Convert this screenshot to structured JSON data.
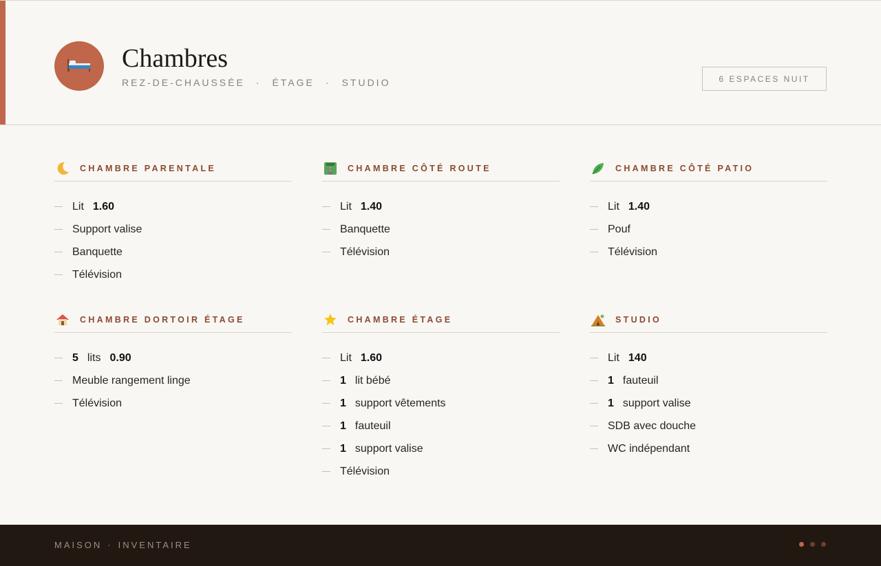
{
  "header": {
    "title": "Chambres",
    "subtitle_parts": [
      "REZ-DE-CHAUSSÉE",
      "ÉTAGE",
      "STUDIO"
    ],
    "separator": "·",
    "count_label": "6 ESPACES NUIT",
    "badge_icon": "bed-icon",
    "accent_color": "#c0664a"
  },
  "rooms": [
    {
      "title": "CHAMBRE PARENTALE",
      "icon": "moon-icon",
      "items": [
        {
          "text": "Lit",
          "value": "1.60"
        },
        {
          "text": "Support valise"
        },
        {
          "text": "Banquette"
        },
        {
          "text": "Télévision"
        }
      ]
    },
    {
      "title": "CHAMBRE CÔTÉ ROUTE",
      "icon": "road-icon",
      "items": [
        {
          "text": "Lit",
          "value": "1.40"
        },
        {
          "text": "Banquette"
        },
        {
          "text": "Télévision"
        }
      ]
    },
    {
      "title": "CHAMBRE CÔTÉ PATIO",
      "icon": "leaf-icon",
      "items": [
        {
          "text": "Lit",
          "value": "1.40"
        },
        {
          "text": "Pouf"
        },
        {
          "text": "Télévision"
        }
      ]
    },
    {
      "title": "CHAMBRE DORTOIR ÉTAGE",
      "icon": "house-icon",
      "items": [
        {
          "qty": "5",
          "text": "lits",
          "value": "0.90"
        },
        {
          "text": "Meuble rangement linge"
        },
        {
          "text": "Télévision"
        }
      ]
    },
    {
      "title": "CHAMBRE ÉTAGE",
      "icon": "star-icon",
      "items": [
        {
          "text": "Lit",
          "value": "1.60"
        },
        {
          "qty": "1",
          "text": "lit bébé"
        },
        {
          "qty": "1",
          "text": "support vêtements"
        },
        {
          "qty": "1",
          "text": "fauteuil"
        },
        {
          "qty": "1",
          "text": "support valise"
        },
        {
          "text": "Télévision"
        }
      ]
    },
    {
      "title": "STUDIO",
      "icon": "camping-icon",
      "items": [
        {
          "text": "Lit",
          "value": "140"
        },
        {
          "qty": "1",
          "text": "fauteuil"
        },
        {
          "qty": "1",
          "text": "support valise"
        },
        {
          "text": "SDB avec douche"
        },
        {
          "text": "WC indépendant"
        }
      ]
    }
  ],
  "footer": {
    "label_parts": [
      "MAISON",
      "INVENTAIRE"
    ],
    "separator": "·",
    "dot_colors": [
      "#c0664a",
      "#6e3f2d",
      "#6e3f2d"
    ]
  }
}
